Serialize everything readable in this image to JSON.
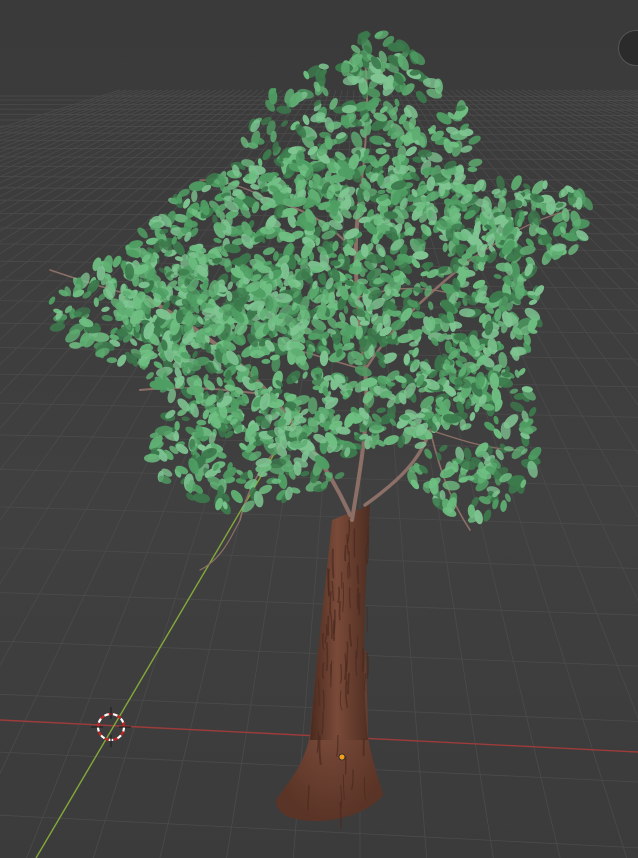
{
  "viewport": {
    "mode": "3D Viewport",
    "shading": "material-preview"
  },
  "scene": {
    "object": "tree",
    "colors": {
      "background": "#3d3d3d",
      "grid_line": "#4b4b4b",
      "x_axis": "#9e3b3b",
      "y_axis": "#84a83a",
      "bark": "#6b4030",
      "bark_dark": "#4a2a1f",
      "leaf_light": "#6fbf82",
      "leaf_mid": "#4f9e63",
      "leaf_dark": "#3c7a4c",
      "branch": "#8c6f66",
      "origin": "#f0a020"
    }
  },
  "icons": {
    "cursor": "3d-cursor-icon",
    "origin": "object-origin-icon",
    "gizmo": "navigation-gizmo-icon"
  }
}
